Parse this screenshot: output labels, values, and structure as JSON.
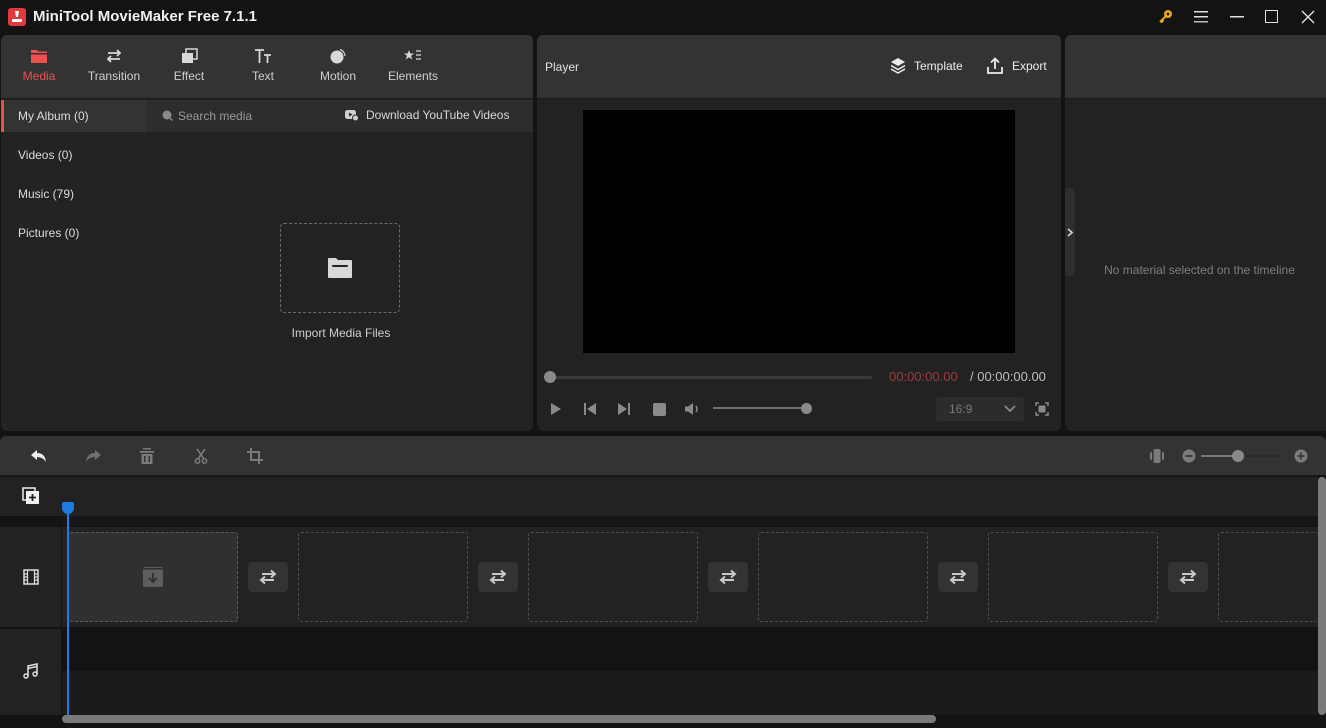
{
  "app": {
    "title": "MiniTool MovieMaker Free 7.1.1",
    "window_controls": [
      "key-icon",
      "menu-icon",
      "minimize-icon",
      "maximize-icon",
      "close-icon"
    ],
    "accent_color": "#ee5050",
    "playhead_color": "#1f7be0"
  },
  "media_toolbar": {
    "tools": [
      {
        "label": "Media",
        "icon": "folder-icon",
        "active": true
      },
      {
        "label": "Transition",
        "icon": "swap-arrows-icon",
        "active": false
      },
      {
        "label": "Effect",
        "icon": "layers-icon",
        "active": false
      },
      {
        "label": "Text",
        "icon": "text-icon",
        "active": false
      },
      {
        "label": "Motion",
        "icon": "motion-ball-icon",
        "active": false
      },
      {
        "label": "Elements",
        "icon": "star-list-icon",
        "active": false
      }
    ]
  },
  "media_sidebar": {
    "items": [
      {
        "label": "My Album (0)",
        "active": true
      },
      {
        "label": "Videos (0)",
        "active": false
      },
      {
        "label": "Music (79)",
        "active": false
      },
      {
        "label": "Pictures (0)",
        "active": false
      }
    ]
  },
  "media_search": {
    "placeholder": "Search media",
    "download_label": "Download YouTube Videos"
  },
  "media_content": {
    "import_label": "Import Media Files"
  },
  "player": {
    "title": "Player",
    "template_label": "Template",
    "export_label": "Export",
    "time_current": "00:00:00.00",
    "time_total": "/ 00:00:00.00",
    "progress": 0,
    "volume_percent": 100,
    "aspect_ratio": "16:9"
  },
  "properties": {
    "empty_message": "No material selected on the timeline"
  },
  "timeline": {
    "toolbar_icons": [
      "undo-icon",
      "redo-icon",
      "delete-icon",
      "split-icon",
      "crop-icon"
    ],
    "zoom_level_fraction": 0.45,
    "video_slots": 6,
    "transition_slots": 5
  }
}
